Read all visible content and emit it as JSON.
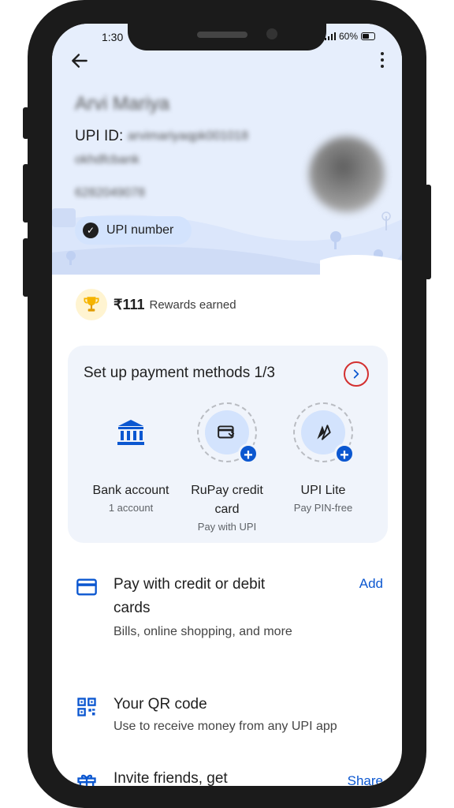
{
  "status_bar": {
    "time": "1:30",
    "battery": "60%"
  },
  "profile": {
    "name": "Arvi Mariya",
    "upi_label": "UPI ID:",
    "upi_id_line1": "arvimariyaqpk001018",
    "upi_id_line2": "okhdfcbank",
    "phone": "6282049078",
    "upi_number_chip": "UPI number"
  },
  "rewards": {
    "amount": "₹111",
    "label": "Rewards earned"
  },
  "setup": {
    "title": "Set up payment methods 1/3",
    "methods": [
      {
        "name": "Bank account",
        "sub": "1 account",
        "icon": "bank-icon"
      },
      {
        "name": "RuPay credit card",
        "sub": "Pay with UPI",
        "icon": "credit-card-icon"
      },
      {
        "name": "UPI Lite",
        "sub": "Pay PIN-free",
        "icon": "upi-lite-icon"
      }
    ]
  },
  "list": {
    "cards": {
      "title": "Pay with credit or debit cards",
      "sub": "Bills, online shopping, and more",
      "action": "Add"
    },
    "qr": {
      "title": "Your QR code",
      "sub": "Use to receive money from any UPI app"
    },
    "invite": {
      "title": "Invite friends, get",
      "action": "Share"
    }
  },
  "colors": {
    "accent": "#0b57d0",
    "header_bg": "#e6eefc",
    "highlight_ring": "#d32f2f",
    "card_bg": "#f0f4fb"
  }
}
